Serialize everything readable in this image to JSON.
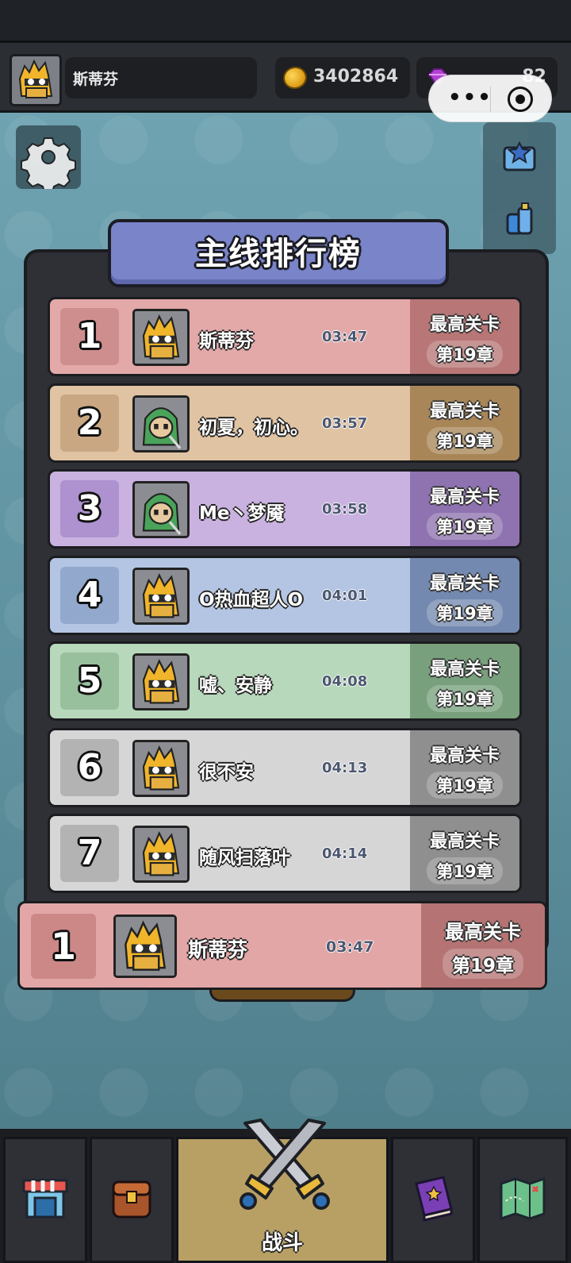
{
  "header": {
    "player_name": "斯蒂芬",
    "coins": "3402864",
    "gems": "82"
  },
  "capsule": {
    "menu_glyph": "•••"
  },
  "leaderboard": {
    "title": "主线排行榜",
    "stage_label": "最高关卡",
    "rows": [
      {
        "rank": "1",
        "name": "斯蒂芬",
        "time": "03:47",
        "chapter": "第19章",
        "avatar": "yellow-ninja",
        "theme": "red"
      },
      {
        "rank": "2",
        "name": "初夏，初心。",
        "time": "03:57",
        "chapter": "第19章",
        "avatar": "green-hood",
        "theme": "orange"
      },
      {
        "rank": "3",
        "name": "Me丶梦魇",
        "time": "03:58",
        "chapter": "第19章",
        "avatar": "green-hood",
        "theme": "purple"
      },
      {
        "rank": "4",
        "name": "O热血超人O",
        "time": "04:01",
        "chapter": "第19章",
        "avatar": "yellow-ninja",
        "theme": "blue"
      },
      {
        "rank": "5",
        "name": "嘘、安静",
        "time": "04:08",
        "chapter": "第19章",
        "avatar": "yellow-ninja",
        "theme": "green"
      },
      {
        "rank": "6",
        "name": "很不安",
        "time": "04:13",
        "chapter": "第19章",
        "avatar": "yellow-ninja",
        "theme": "gray"
      },
      {
        "rank": "7",
        "name": "随风扫落叶",
        "time": "04:14",
        "chapter": "第19章",
        "avatar": "yellow-ninja",
        "theme": "gray"
      }
    ],
    "my_row": {
      "rank": "1",
      "name": "斯蒂芬",
      "time": "03:47",
      "chapter": "第19章"
    }
  },
  "themes": {
    "red": {
      "bg": "#e3a9a9",
      "box": "#cf8e8e",
      "stage": "#b87676"
    },
    "orange": {
      "bg": "#e0c3a2",
      "box": "#c9a783",
      "stage": "#a88658"
    },
    "purple": {
      "bg": "#c9b2e0",
      "box": "#ad92cf",
      "stage": "#8f72b0"
    },
    "blue": {
      "bg": "#b3c5e2",
      "box": "#93a8cd",
      "stage": "#7489b0"
    },
    "green": {
      "bg": "#b7d8bb",
      "box": "#98c09d",
      "stage": "#78a07c"
    },
    "gray": {
      "bg": "#d6d6d6",
      "box": "#b3b3b3",
      "stage": "#8f8f8f"
    }
  },
  "nav": {
    "items": [
      {
        "id": "shop",
        "icon": "shop-icon",
        "label": ""
      },
      {
        "id": "bag",
        "icon": "backpack-icon",
        "label": ""
      },
      {
        "id": "battle",
        "icon": "crossed-swords-icon",
        "label": "战斗"
      },
      {
        "id": "book",
        "icon": "spellbook-icon",
        "label": ""
      },
      {
        "id": "map",
        "icon": "map-icon",
        "label": ""
      }
    ]
  }
}
